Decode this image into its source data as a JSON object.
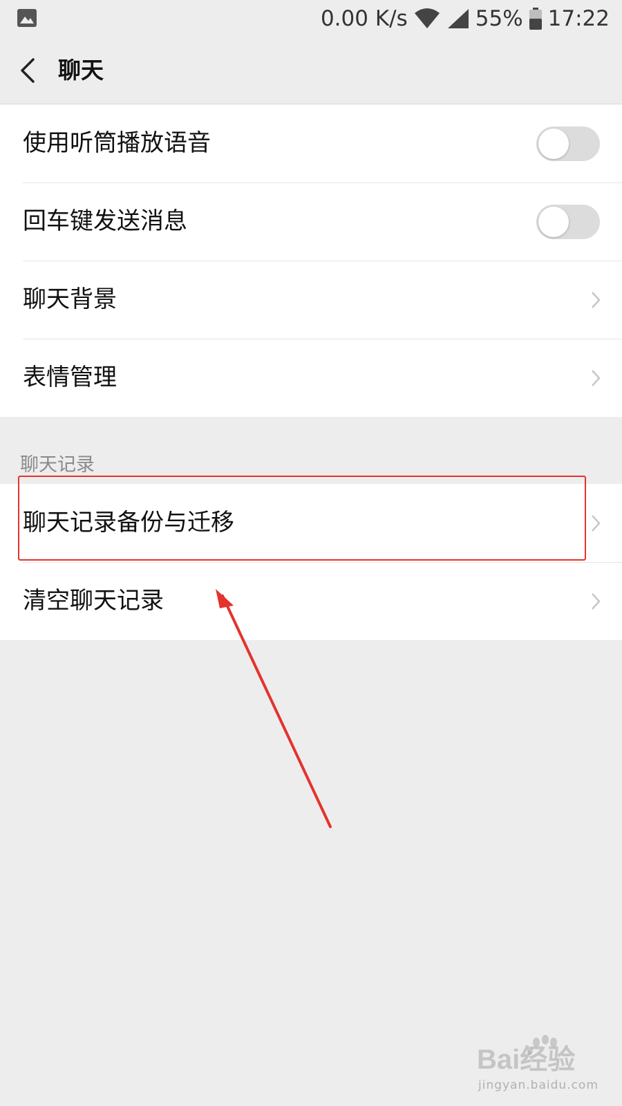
{
  "status_bar": {
    "network_speed": "0.00 K/s",
    "battery": "55%",
    "time": "17:22"
  },
  "nav": {
    "title": "聊天"
  },
  "settings": {
    "general": [
      {
        "label": "使用听筒播放语音",
        "control": "toggle",
        "on": false
      },
      {
        "label": "回车键发送消息",
        "control": "toggle",
        "on": false
      },
      {
        "label": "聊天背景",
        "control": "chevron"
      },
      {
        "label": "表情管理",
        "control": "chevron"
      }
    ],
    "history_header": "聊天记录",
    "history": [
      {
        "label": "聊天记录备份与迁移",
        "control": "chevron"
      },
      {
        "label": "清空聊天记录",
        "control": "chevron"
      }
    ]
  },
  "watermark": {
    "logo_text": "Bai经验",
    "url": "jingyan.baidu.com"
  },
  "colors": {
    "background": "#ededed",
    "row_background": "#ffffff",
    "annotation_red": "#e4322d",
    "toggle_off": "#dcdcdc"
  }
}
